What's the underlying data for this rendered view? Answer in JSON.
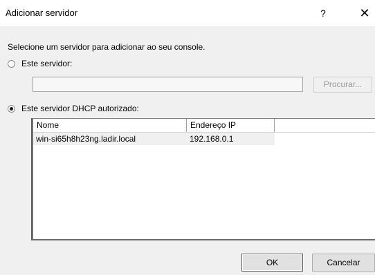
{
  "window": {
    "title": "Adicionar servidor",
    "help_glyph": "?",
    "close_glyph": "✕"
  },
  "dialog": {
    "prompt": "Selecione um servidor para adicionar ao seu console.",
    "option_this_server": {
      "label": "Este servidor:",
      "checked": false,
      "value": ""
    },
    "browse_label": "Procurar...",
    "option_dhcp": {
      "label": "Este servidor DHCP autorizado:",
      "checked": true
    },
    "list": {
      "columns": [
        "Nome",
        "Endereço IP",
        ""
      ],
      "rows": [
        {
          "name": "win-si65h8h23ng.ladir.local",
          "ip": "192.168.0.1"
        }
      ]
    },
    "ok_label": "OK",
    "cancel_label": "Cancelar"
  }
}
